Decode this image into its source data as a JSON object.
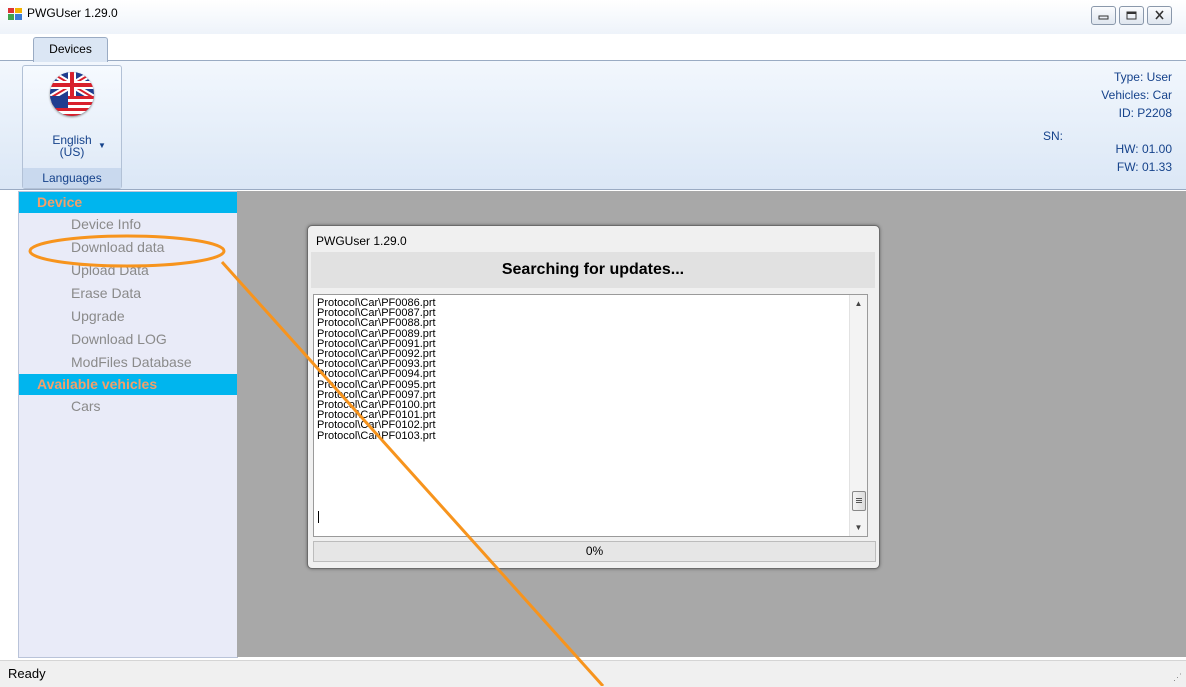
{
  "window": {
    "title": "PWGUser 1.29.0"
  },
  "tabs": [
    {
      "label": "Devices"
    }
  ],
  "ribbon": {
    "language": {
      "label": "English\n(US)",
      "group_caption": "Languages"
    },
    "device_info": {
      "type": "Type: User",
      "vehicles": "Vehicles: Car",
      "id": "ID: P2208",
      "sn": "SN:",
      "hw": "HW: 01.00",
      "fw": "FW: 01.33"
    }
  },
  "sidebar": {
    "sections": [
      {
        "title": "Device",
        "items": [
          "Device Info",
          "Download data",
          "Upload Data",
          "Erase Data",
          "Upgrade",
          "Download LOG",
          "ModFiles Database"
        ]
      },
      {
        "title": "Available vehicles",
        "items": [
          "Cars"
        ]
      }
    ]
  },
  "dialog": {
    "title": "PWGUser 1.29.0",
    "heading": "Searching for updates...",
    "log_lines": [
      "Protocol\\Car\\PF0086.prt",
      "Protocol\\Car\\PF0087.prt",
      "Protocol\\Car\\PF0088.prt",
      "Protocol\\Car\\PF0089.prt",
      "Protocol\\Car\\PF0091.prt",
      "Protocol\\Car\\PF0092.prt",
      "Protocol\\Car\\PF0093.prt",
      "Protocol\\Car\\PF0094.prt",
      "Protocol\\Car\\PF0095.prt",
      "Protocol\\Car\\PF0097.prt",
      "Protocol\\Car\\PF0100.prt",
      "Protocol\\Car\\PF0101.prt",
      "Protocol\\Car\\PF0102.prt",
      "Protocol\\Car\\PF0103.prt"
    ],
    "progress": {
      "label": "0%",
      "value": 0
    }
  },
  "statusbar": {
    "text": "Ready"
  },
  "colors": {
    "section_header_bg": "#00b5ee",
    "section_header_text": "#f3a06a",
    "annotation": "#f7941d"
  },
  "icons": {
    "app": "app-window-icon",
    "flag": "uk-us-flag-icon"
  }
}
